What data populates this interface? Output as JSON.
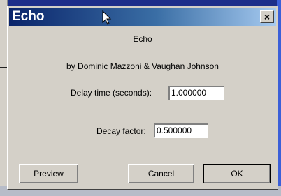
{
  "window": {
    "title": "Echo",
    "close_glyph": "×"
  },
  "dialog": {
    "heading": "Echo",
    "authors": "by Dominic Mazzoni & Vaughan Johnson",
    "delay_label": "Delay time (seconds):",
    "delay_value": "1.000000",
    "decay_label": "Decay factor:",
    "decay_value": "0.500000"
  },
  "buttons": {
    "preview": "Preview",
    "cancel": "Cancel",
    "ok": "OK"
  },
  "colors": {
    "titlebar_start": "#0a246a",
    "titlebar_end": "#a6caf0",
    "dialog_face": "#d4d0c8"
  }
}
